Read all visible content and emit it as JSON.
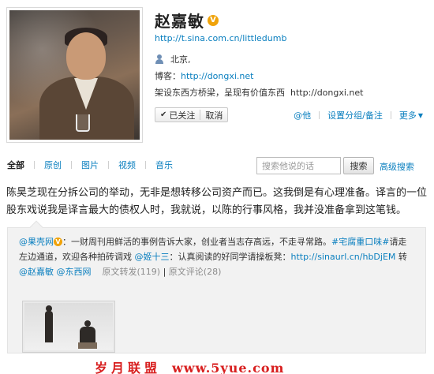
{
  "profile": {
    "name": "赵嘉敏",
    "verified_badge": "V",
    "url": "http://t.sina.com.cn/littledumb",
    "location": "北京,",
    "blog_label": "博客：",
    "blog_url": "http://dongxi.net",
    "bio_text": "架设东西方桥梁，呈现有价值东西",
    "bio_url": "http://dongxi.net"
  },
  "follow": {
    "followed_label": "已关注",
    "followed_icon": "check-icon",
    "cancel_label": "取消"
  },
  "actions": {
    "mention": "@他",
    "group_note": "设置分组/备注",
    "more": "更多"
  },
  "tabs": [
    "全部",
    "原创",
    "图片",
    "视频",
    "音乐"
  ],
  "search": {
    "placeholder": "搜索他说的话",
    "button": "搜索",
    "advanced": "高级搜索"
  },
  "post": {
    "text": "陈昊芝现在分拆公司的举动，无非是想转移公司资产而已。这我倒是有心理准备。译言的一位股东戏说我是译言最大的债权人时，我就说，以陈的行事风格，我并没准备拿到这笔钱。"
  },
  "repost": {
    "author": "@果壳网",
    "author_badge": "V",
    "part1": "：一财周刊用鲜活的事例告诉大家，创业者当志存高远，不走寻常路。",
    "topic": "#宅腐重口味#",
    "part2": "请走左边通道，欢迎各种拍砖调戏 ",
    "mention1": "@姬十三",
    "part3": "：认真阅读的好同学请操板凳：",
    "short_url": "http://sinaurl.cn/hbDjEM",
    "part4": " 转 ",
    "mention2": "@赵嘉敏",
    "mention3": "@东西网",
    "repost_count": "原文转发(119)",
    "comment_count": "原文评论(28)"
  },
  "watermark": {
    "text": "岁月联盟",
    "site": "www.5yue.com"
  },
  "colors": {
    "link": "#0a7fbf",
    "verified": "#f0a30a",
    "watermark": "#d81f1f"
  }
}
